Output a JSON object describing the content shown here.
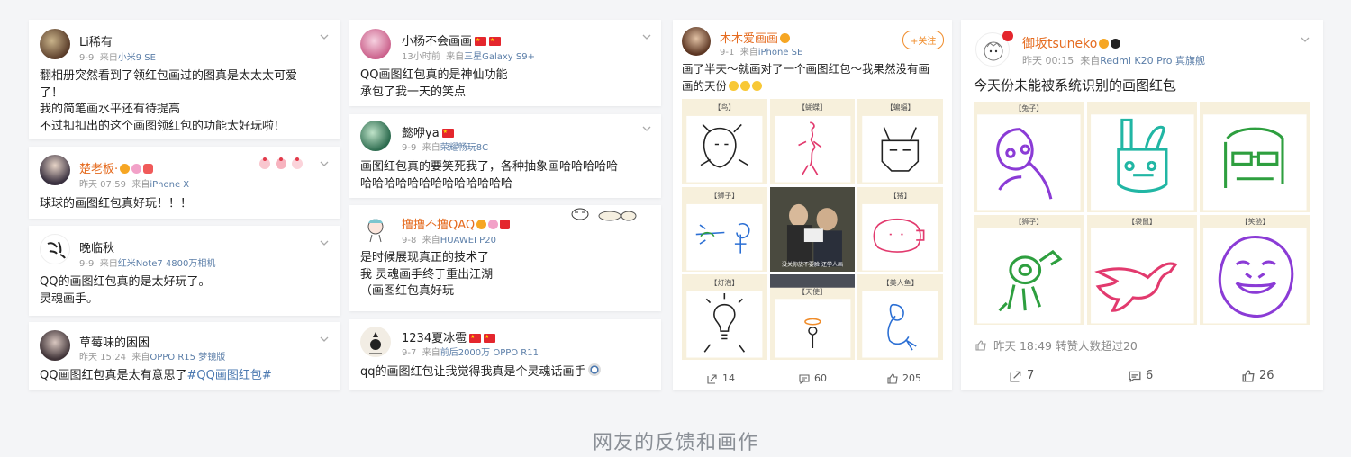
{
  "caption": "网友的反馈和画作",
  "col1": [
    {
      "name": "Li稀有",
      "date": "9-9",
      "source_prefix": "来自",
      "device": "小米9 SE",
      "lines": [
        "翻相册突然看到了领红包画过的图真是太太太可爱",
        "了！",
        "我的简笔画水平还有待提高",
        "不过扣扣出的这个画图领红包的功能太好玩啦！"
      ]
    },
    {
      "name": "楚老板·",
      "date": "昨天 07:59",
      "source_prefix": "来自",
      "device": "iPhone X",
      "lines": [
        "球球的画图红包真好玩！！！"
      ]
    },
    {
      "name": "晚临秋",
      "date": "9-9",
      "source_prefix": "来自",
      "device": "红米Note7 4800万相机",
      "lines": [
        "QQ的画图红包真的是太好玩了。",
        "灵魂画手。"
      ]
    },
    {
      "name": "草莓味的困困",
      "date": "昨天 15:24",
      "source_prefix": "来自",
      "device": "OPPO R15 梦镜版",
      "line_plain": "QQ画图红包真是太有意思了",
      "topic": "#QQ画图红包#"
    }
  ],
  "col2": [
    {
      "name": "小杨不会画画",
      "date": "13小时前",
      "source_prefix": "来自",
      "device": "三星Galaxy S9+",
      "lines": [
        "QQ画图红包真的是神仙功能",
        "承包了我一天的笑点"
      ]
    },
    {
      "name": "懿咿ya",
      "date": "9-9",
      "source_prefix": "来自",
      "device": "荣耀畅玩8C",
      "lines": [
        "画图红包真的要笑死我了，各种抽象画哈哈哈哈哈",
        "哈哈哈哈哈哈哈哈哈哈哈哈哈"
      ]
    },
    {
      "name": "撸撸不撸QAQ",
      "date": "9-8",
      "source_prefix": "来自",
      "device": "HUAWEI P20",
      "lines": [
        "是时候展现真正的技术了",
        "我 灵魂画手终于重出江湖",
        "（画图红包真好玩"
      ]
    },
    {
      "name": "1234夏冰雹",
      "date": "9-7",
      "source_prefix": "来自",
      "device": "前后2000万 OPPO R11",
      "lines": [
        "qq的画图红包让我觉得我真是个灵魂话画手"
      ]
    }
  ],
  "post3": {
    "name": "木木爱画画",
    "date": "9-1",
    "source_prefix": "来自",
    "device": "iPhone SE",
    "follow": "+关注",
    "lines": [
      "画了半天～就画对了一个画图红包～我果然没有画",
      "画的天份"
    ],
    "cell_labels": [
      "【鸟】",
      "【蝴蝶】",
      "【蝙蝠】",
      "【狮子】",
      "",
      "【猪】",
      "【灯泡】",
      "【天使】",
      "【美人鱼】"
    ],
    "meme_caption": "没关你放不要脸 还学人画",
    "forward": "14",
    "comment": "60",
    "like": "205"
  },
  "post4": {
    "name": "御坂tsuneko",
    "date": "昨天 00:15",
    "source_prefix": "来自",
    "device": "Redmi K20 Pro 真旗舰",
    "text": "今天份未能被系统识别的画图红包",
    "cell_labels": [
      "【兔子】",
      "",
      "",
      "【狮子】",
      "【袋鼠】",
      "【笑脸】"
    ],
    "like_meta": "昨天 18:49 转赞人数超过20",
    "forward": "7",
    "comment": "6",
    "like": "26",
    "colors": {
      "purple": "#8b3bd6",
      "teal": "#21b6a4",
      "green": "#2e9f3f",
      "pink": "#e23a6e"
    }
  },
  "colors": {
    "link": "#4a78b0",
    "orange": "#f08c2a",
    "flag_red": "#e4262d"
  }
}
